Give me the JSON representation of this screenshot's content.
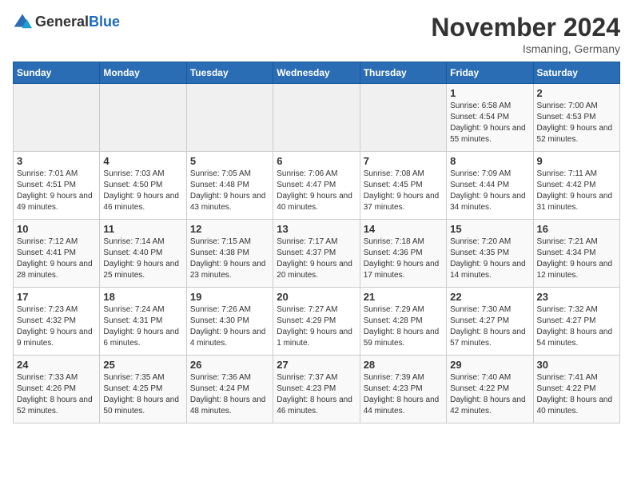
{
  "logo": {
    "general": "General",
    "blue": "Blue"
  },
  "title": "November 2024",
  "subtitle": "Ismaning, Germany",
  "weekdays": [
    "Sunday",
    "Monday",
    "Tuesday",
    "Wednesday",
    "Thursday",
    "Friday",
    "Saturday"
  ],
  "weeks": [
    [
      {
        "day": "",
        "info": ""
      },
      {
        "day": "",
        "info": ""
      },
      {
        "day": "",
        "info": ""
      },
      {
        "day": "",
        "info": ""
      },
      {
        "day": "",
        "info": ""
      },
      {
        "day": "1",
        "info": "Sunrise: 6:58 AM\nSunset: 4:54 PM\nDaylight: 9 hours and 55 minutes."
      },
      {
        "day": "2",
        "info": "Sunrise: 7:00 AM\nSunset: 4:53 PM\nDaylight: 9 hours and 52 minutes."
      }
    ],
    [
      {
        "day": "3",
        "info": "Sunrise: 7:01 AM\nSunset: 4:51 PM\nDaylight: 9 hours and 49 minutes."
      },
      {
        "day": "4",
        "info": "Sunrise: 7:03 AM\nSunset: 4:50 PM\nDaylight: 9 hours and 46 minutes."
      },
      {
        "day": "5",
        "info": "Sunrise: 7:05 AM\nSunset: 4:48 PM\nDaylight: 9 hours and 43 minutes."
      },
      {
        "day": "6",
        "info": "Sunrise: 7:06 AM\nSunset: 4:47 PM\nDaylight: 9 hours and 40 minutes."
      },
      {
        "day": "7",
        "info": "Sunrise: 7:08 AM\nSunset: 4:45 PM\nDaylight: 9 hours and 37 minutes."
      },
      {
        "day": "8",
        "info": "Sunrise: 7:09 AM\nSunset: 4:44 PM\nDaylight: 9 hours and 34 minutes."
      },
      {
        "day": "9",
        "info": "Sunrise: 7:11 AM\nSunset: 4:42 PM\nDaylight: 9 hours and 31 minutes."
      }
    ],
    [
      {
        "day": "10",
        "info": "Sunrise: 7:12 AM\nSunset: 4:41 PM\nDaylight: 9 hours and 28 minutes."
      },
      {
        "day": "11",
        "info": "Sunrise: 7:14 AM\nSunset: 4:40 PM\nDaylight: 9 hours and 25 minutes."
      },
      {
        "day": "12",
        "info": "Sunrise: 7:15 AM\nSunset: 4:38 PM\nDaylight: 9 hours and 23 minutes."
      },
      {
        "day": "13",
        "info": "Sunrise: 7:17 AM\nSunset: 4:37 PM\nDaylight: 9 hours and 20 minutes."
      },
      {
        "day": "14",
        "info": "Sunrise: 7:18 AM\nSunset: 4:36 PM\nDaylight: 9 hours and 17 minutes."
      },
      {
        "day": "15",
        "info": "Sunrise: 7:20 AM\nSunset: 4:35 PM\nDaylight: 9 hours and 14 minutes."
      },
      {
        "day": "16",
        "info": "Sunrise: 7:21 AM\nSunset: 4:34 PM\nDaylight: 9 hours and 12 minutes."
      }
    ],
    [
      {
        "day": "17",
        "info": "Sunrise: 7:23 AM\nSunset: 4:32 PM\nDaylight: 9 hours and 9 minutes."
      },
      {
        "day": "18",
        "info": "Sunrise: 7:24 AM\nSunset: 4:31 PM\nDaylight: 9 hours and 6 minutes."
      },
      {
        "day": "19",
        "info": "Sunrise: 7:26 AM\nSunset: 4:30 PM\nDaylight: 9 hours and 4 minutes."
      },
      {
        "day": "20",
        "info": "Sunrise: 7:27 AM\nSunset: 4:29 PM\nDaylight: 9 hours and 1 minute."
      },
      {
        "day": "21",
        "info": "Sunrise: 7:29 AM\nSunset: 4:28 PM\nDaylight: 8 hours and 59 minutes."
      },
      {
        "day": "22",
        "info": "Sunrise: 7:30 AM\nSunset: 4:27 PM\nDaylight: 8 hours and 57 minutes."
      },
      {
        "day": "23",
        "info": "Sunrise: 7:32 AM\nSunset: 4:27 PM\nDaylight: 8 hours and 54 minutes."
      }
    ],
    [
      {
        "day": "24",
        "info": "Sunrise: 7:33 AM\nSunset: 4:26 PM\nDaylight: 8 hours and 52 minutes."
      },
      {
        "day": "25",
        "info": "Sunrise: 7:35 AM\nSunset: 4:25 PM\nDaylight: 8 hours and 50 minutes."
      },
      {
        "day": "26",
        "info": "Sunrise: 7:36 AM\nSunset: 4:24 PM\nDaylight: 8 hours and 48 minutes."
      },
      {
        "day": "27",
        "info": "Sunrise: 7:37 AM\nSunset: 4:23 PM\nDaylight: 8 hours and 46 minutes."
      },
      {
        "day": "28",
        "info": "Sunrise: 7:39 AM\nSunset: 4:23 PM\nDaylight: 8 hours and 44 minutes."
      },
      {
        "day": "29",
        "info": "Sunrise: 7:40 AM\nSunset: 4:22 PM\nDaylight: 8 hours and 42 minutes."
      },
      {
        "day": "30",
        "info": "Sunrise: 7:41 AM\nSunset: 4:22 PM\nDaylight: 8 hours and 40 minutes."
      }
    ]
  ]
}
